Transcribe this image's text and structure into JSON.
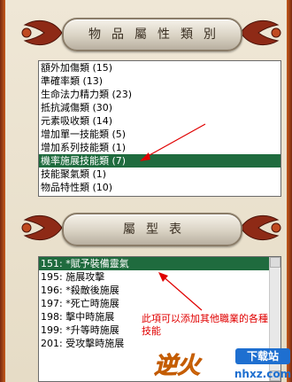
{
  "categories": {
    "title": "物品屬性類別",
    "items": [
      {
        "label": "額外加傷類 (15)",
        "selected": false
      },
      {
        "label": "準確率類 (13)",
        "selected": false
      },
      {
        "label": "生命法力精力類 (23)",
        "selected": false
      },
      {
        "label": "抵抗減傷類 (30)",
        "selected": false
      },
      {
        "label": "元素吸收類 (14)",
        "selected": false
      },
      {
        "label": "增加單一技能類 (5)",
        "selected": false
      },
      {
        "label": "增加系列技能類 (1)",
        "selected": false
      },
      {
        "label": "機率施展技能類 (7)",
        "selected": true
      },
      {
        "label": "技能聚氣類 (1)",
        "selected": false
      },
      {
        "label": "物品特性類 (10)",
        "selected": false
      }
    ]
  },
  "types": {
    "title": "屬型表",
    "items": [
      {
        "label": "151: *賦予裝備靈氣",
        "selected": true
      },
      {
        "label": "195: 施展攻擊",
        "selected": false
      },
      {
        "label": "196: *殺敵後施展",
        "selected": false
      },
      {
        "label": "197: *死亡時施展",
        "selected": false
      },
      {
        "label": "198: 擊中時施展",
        "selected": false
      },
      {
        "label": "199: *升等時施展",
        "selected": false
      },
      {
        "label": "201: 受攻擊時施展",
        "selected": false
      }
    ]
  },
  "annotation": "此項可以添加其他職業的各種技能",
  "watermark": {
    "brand": "逆火",
    "site_label": "下载站",
    "domain": "nhxz.com"
  },
  "colors": {
    "selection": "#1f6b3e",
    "annotation": "#e00000",
    "arrow": "#e00000"
  }
}
